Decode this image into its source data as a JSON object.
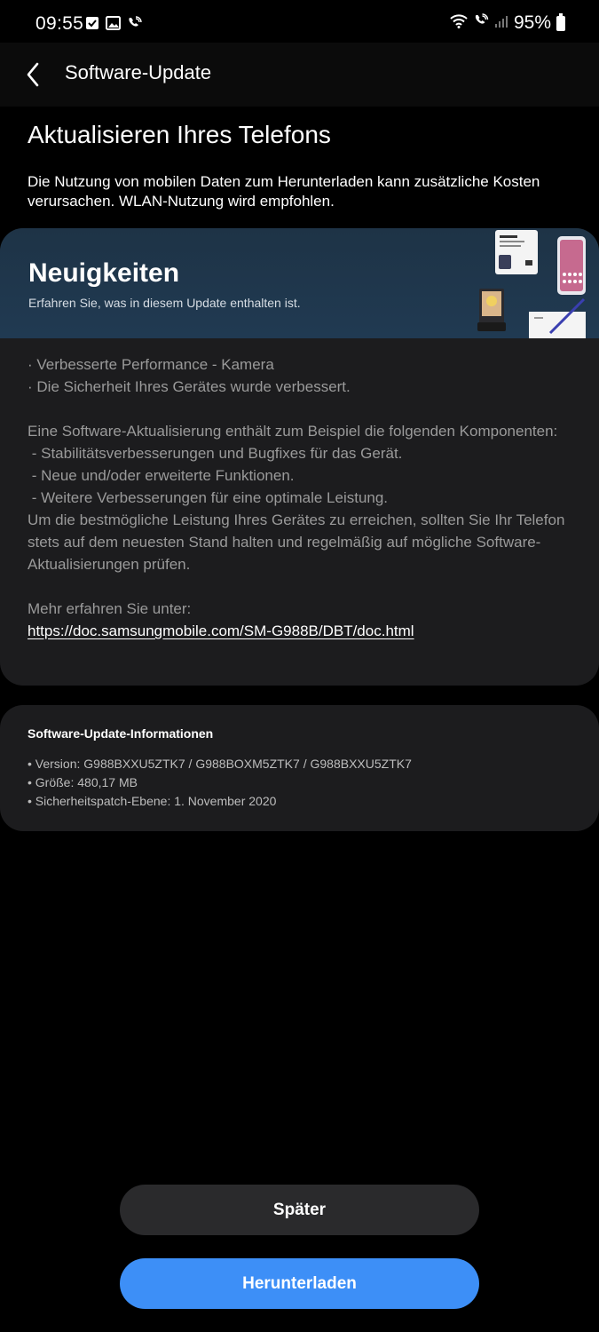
{
  "status_bar": {
    "time": "09:55",
    "battery": "95%",
    "icons_left": [
      "check-notification-icon",
      "image-notification-icon",
      "wifi-call-icon"
    ],
    "icons_right": [
      "wifi-icon",
      "wifi-call-icon",
      "signal-icon",
      "battery-icon"
    ]
  },
  "app_bar": {
    "title": "Software-Update",
    "back_icon": "chevron-left-icon"
  },
  "heading": "Aktualisieren Ihres Telefons",
  "intro": "Die Nutzung von mobilen Daten zum Herunterladen kann zusätzliche Kosten verursachen. WLAN-Nutzung wird empfohlen.",
  "news": {
    "title": "Neuigkeiten",
    "subtitle": "Erfahren Sie, was in diesem Update enthalten ist.",
    "bullets": [
      "· Verbesserte Performance - Kamera",
      "· Die Sicherheit Ihres Gerätes wurde verbessert."
    ],
    "paragraph_intro": "Eine Software-Aktualisierung enthält zum Beispiel die folgenden Komponenten:",
    "components": [
      " - Stabilitätsverbesserungen und Bugfixes für das Gerät.",
      " - Neue und/oder erweiterte Funktionen.",
      " - Weitere Verbesserungen für eine optimale Leistung."
    ],
    "paragraph_outro": "Um die bestmögliche Leistung Ihres Gerätes zu erreichen, sollten Sie Ihr Telefon stets auf dem neuesten Stand halten und regelmäßig auf mögliche Software-Aktualisierungen prüfen.",
    "more_label": "Mehr erfahren Sie unter:",
    "link": "https://doc.samsungmobile.com/SM-G988B/DBT/doc.html"
  },
  "info": {
    "heading": "Software-Update-Informationen",
    "version": "• Version: G988BXXU5ZTK7 / G988BOXM5ZTK7 / G988BXXU5ZTK7",
    "size": "• Größe: 480,17 MB",
    "patch": "• Sicherheitspatch-Ebene: 1. November 2020"
  },
  "buttons": {
    "later": "Später",
    "download": "Herunterladen"
  },
  "colors": {
    "background": "#000000",
    "card": "#1c1c1e",
    "banner": "#203a52",
    "primary_button": "#3d8ff7",
    "secondary_button": "#2a2a2c"
  }
}
